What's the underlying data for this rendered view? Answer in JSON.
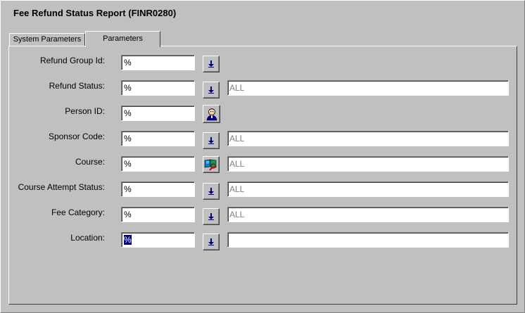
{
  "window": {
    "title": "Fee Refund Status Report (FINR0280)"
  },
  "tabs": [
    {
      "label": "System Parameters",
      "active": false
    },
    {
      "label": "Parameters",
      "active": true
    }
  ],
  "fields": [
    {
      "label": "Refund Group Id:",
      "value": "%",
      "button": "down-arrow-icon"
    },
    {
      "label": "Refund Status:",
      "value": "%",
      "button": "down-arrow-icon",
      "description": "ALL"
    },
    {
      "label": "Person ID:",
      "value": "%",
      "button": "person-search-icon"
    },
    {
      "label": "Sponsor Code:",
      "value": "%",
      "button": "down-arrow-icon",
      "description": "ALL"
    },
    {
      "label": "Course:",
      "value": "%",
      "button": "course-search-icon",
      "description": "ALL"
    },
    {
      "label": "Course Attempt Status:",
      "value": "%",
      "button": "down-arrow-icon",
      "description": "ALL"
    },
    {
      "label": "Fee Category:",
      "value": "%",
      "button": "down-arrow-icon",
      "description": "ALL"
    },
    {
      "label": "Location:",
      "value": "%",
      "button": "down-arrow-icon",
      "description": ""
    }
  ],
  "colors": {
    "background": "#c0c0c0",
    "selection": "#000080",
    "icon_blue": "#000080"
  }
}
